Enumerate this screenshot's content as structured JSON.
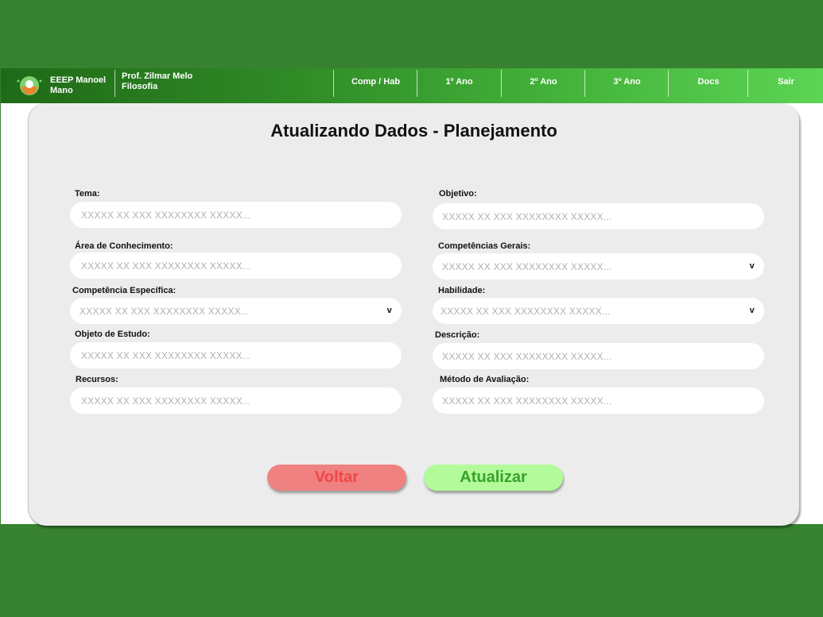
{
  "header": {
    "school_line1": "EEEP Manoel",
    "school_line2": "Mano",
    "teacher_name": "Prof. Zilmar Melo",
    "subject": "Filosofia",
    "nav": [
      "Comp / Hab",
      "1º Ano",
      "2º Ano",
      "3º Ano",
      "Docs",
      "Sair"
    ]
  },
  "page": {
    "title": "Atualizando Dados - Planejamento"
  },
  "form": {
    "tema": {
      "label": "Tema:",
      "placeholder": "XXXXX XX XXX XXXXXXXX XXXXX..."
    },
    "objetivo": {
      "label": "Objetivo:",
      "placeholder": "XXXXX XX XXX XXXXXXXX XXXXX..."
    },
    "area": {
      "label": "Área de Conhecimento:",
      "placeholder": "XXXXX XX XXX XXXXXXXX XXXXX..."
    },
    "competencias_gerais": {
      "label": "Competências Gerais:",
      "placeholder": "XXXXX XX XXX XXXXXXXX XXXXX...",
      "chevron": "v"
    },
    "competencia_especifica": {
      "label": "Competência Específica:",
      "placeholder": "XXXXX XX XXX XXXXXXXX XXXXX...",
      "chevron": "v"
    },
    "habilidade": {
      "label": "Habilidade:",
      "placeholder": "XXXXX XX XXX XXXXXXXX XXXXX...",
      "chevron": "v"
    },
    "objeto": {
      "label": "Objeto de Estudo:",
      "placeholder": "XXXXX XX XXX XXXXXXXX XXXXX..."
    },
    "descricao": {
      "label": "Descrição:",
      "placeholder": "XXXXX XX XXX XXXXXXXX XXXXX..."
    },
    "recursos": {
      "label": "Recursos:",
      "placeholder": "XXXXX XX XXX XXXXXXXX XXXXX..."
    },
    "metodo": {
      "label": "Método de Avaliação:",
      "placeholder": "XXXXX XX XXX XXXXXXXX XXXXX..."
    }
  },
  "buttons": {
    "back": "Voltar",
    "update": "Atualizar"
  },
  "colors": {
    "background": "#378230",
    "back_button": "#f08181",
    "update_button": "#b3fb9a"
  }
}
